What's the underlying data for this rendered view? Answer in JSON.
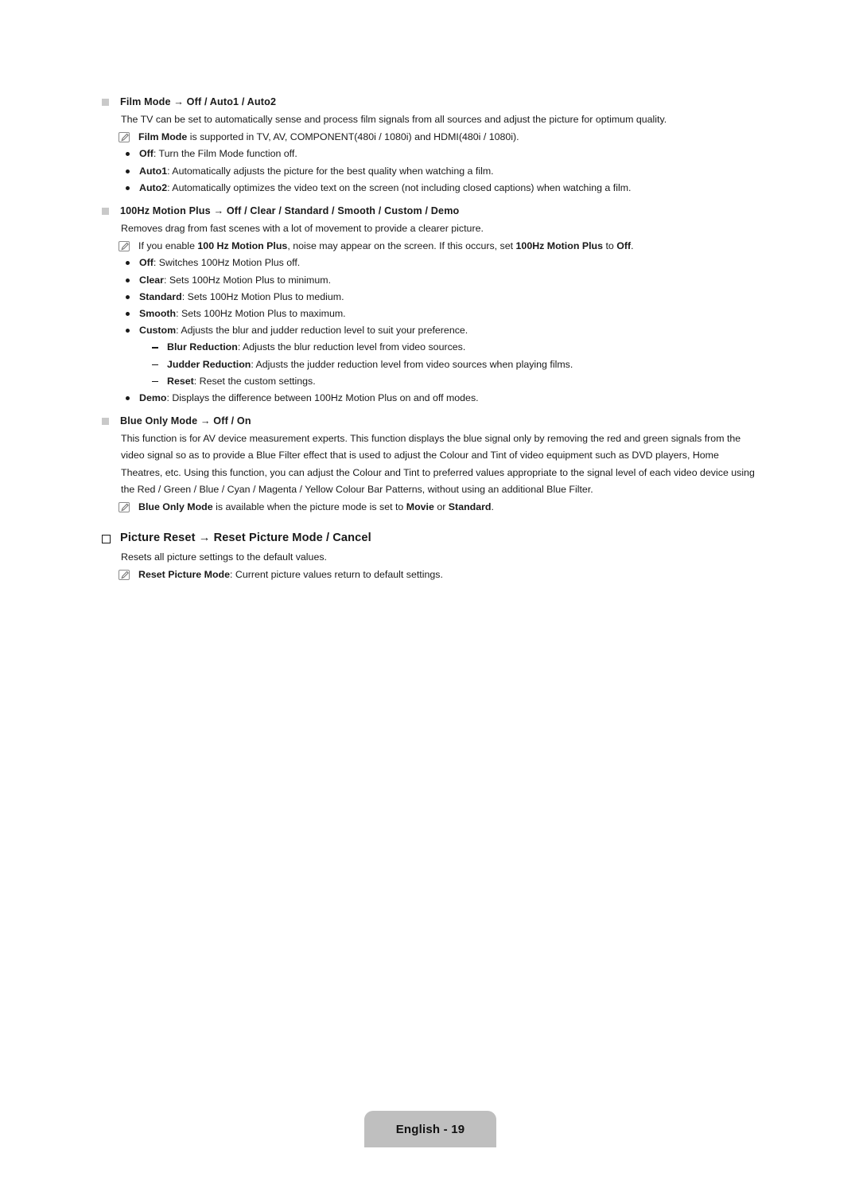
{
  "document": {
    "page_label": "English - 19",
    "language": "English",
    "page_number": "19"
  },
  "sections": [
    {
      "id": "film-mode",
      "marker": "gray-square",
      "heading": "Film Mode → Off / Auto1 / Auto2",
      "intro": "The TV can be set to automatically sense and process film signals from all sources and adjust the picture for optimum quality.",
      "note": {
        "icon": "note-pencil-icon",
        "bold_lead": "Film Mode",
        "rest": " is supported in TV, AV, COMPONENT(480i / 1080i) and HDMI(480i / 1080i)."
      },
      "bullets": [
        {
          "term": "Off",
          "desc": ": Turn the Film Mode function off."
        },
        {
          "term": "Auto1",
          "desc": ": Automatically adjusts the picture for the best quality when watching a film."
        },
        {
          "term": "Auto2",
          "desc": ": Automatically optimizes the video text on the screen (not including closed captions) when watching a film."
        }
      ]
    },
    {
      "id": "motion-plus",
      "marker": "gray-square",
      "heading": "100Hz Motion Plus → Off / Clear / Standard / Smooth / Custom / Demo",
      "intro": "Removes drag from fast scenes with a lot of movement to provide a clearer picture.",
      "note": {
        "icon": "note-pencil-icon",
        "part1": "If you enable ",
        "bold1": "100 Hz Motion Plus",
        "part2": ", noise may appear on the screen. If this occurs, set ",
        "bold2": "100Hz Motion Plus",
        "part3": " to ",
        "bold3": "Off",
        "part4": "."
      },
      "bullets": [
        {
          "term": "Off",
          "desc": ": Switches 100Hz Motion Plus off."
        },
        {
          "term": "Clear",
          "desc": ": Sets 100Hz Motion Plus to minimum."
        },
        {
          "term": "Standard",
          "desc": ": Sets 100Hz Motion Plus to medium."
        },
        {
          "term": "Smooth",
          "desc": ": Sets 100Hz Motion Plus to maximum."
        },
        {
          "term": "Custom",
          "desc": ": Adjusts the blur and judder reduction level to suit your preference."
        }
      ],
      "subbullets": [
        {
          "term": "Blur Reduction",
          "desc": ": Adjusts the blur reduction level from video sources."
        },
        {
          "term": "Judder Reduction",
          "desc": ": Adjusts the judder reduction level from video sources when playing films."
        },
        {
          "term": "Reset",
          "desc": ": Reset the custom settings."
        }
      ],
      "last_bullet": {
        "term": "Demo",
        "desc": ": Displays the difference between 100Hz Motion Plus on and off modes."
      }
    },
    {
      "id": "blue-only-mode",
      "marker": "gray-square",
      "heading": "Blue Only Mode → Off / On",
      "intro": "This function is for AV device measurement experts. This function displays the blue signal only by removing the red and green signals from the video signal so as to provide a Blue Filter effect that is used to adjust the Colour and Tint of video equipment such as DVD players, Home Theatres, etc. Using this function, you can adjust the Colour and Tint to preferred values appropriate to the signal level of each video device using the Red / Green / Blue / Cyan / Magenta / Yellow Colour Bar Patterns, without using an additional Blue Filter.",
      "note": {
        "icon": "note-pencil-icon",
        "part1": "",
        "bold1": "Blue Only Mode",
        "part2": " is available when the picture mode is set to ",
        "bold2": "Movie",
        "part3": " or ",
        "bold3": "Standard",
        "part4": "."
      }
    },
    {
      "id": "picture-reset",
      "marker": "outlined-square",
      "heading": "Picture Reset → Reset Picture Mode / Cancel",
      "intro": "Resets all picture settings to the default values.",
      "note": {
        "icon": "note-pencil-icon",
        "bold_lead": "Reset Picture Mode",
        "rest": ": Current picture values return to default settings."
      }
    }
  ],
  "colors": {
    "text": "#1a1a1a",
    "marker_gray": "#c9c9c9",
    "footer_gray": "#bfbfbf",
    "page_background": "#ffffff"
  }
}
